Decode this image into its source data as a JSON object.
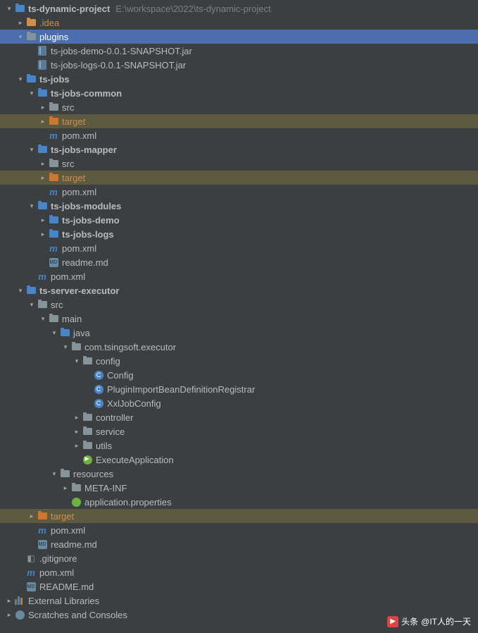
{
  "root": {
    "name": "ts-dynamic-project",
    "path": "E:\\workspace\\2022\\ts-dynamic-project"
  },
  "tree": [
    {
      "d": 0,
      "ar": "open",
      "ic": "folder-blue",
      "lbl": "ts-dynamic-project",
      "bold": true,
      "path": "E:\\workspace\\2022\\ts-dynamic-project"
    },
    {
      "d": 1,
      "ar": "closed",
      "ic": "folder-open",
      "lbl": ".idea",
      "orange": true
    },
    {
      "d": 1,
      "ar": "open",
      "ic": "folder-grey",
      "lbl": "plugins",
      "sel": true
    },
    {
      "d": 2,
      "ar": "none",
      "ic": "jar",
      "lbl": "ts-jobs-demo-0.0.1-SNAPSHOT.jar"
    },
    {
      "d": 2,
      "ar": "none",
      "ic": "jar",
      "lbl": "ts-jobs-logs-0.0.1-SNAPSHOT.jar"
    },
    {
      "d": 1,
      "ar": "open",
      "ic": "folder-blue",
      "lbl": "ts-jobs",
      "bold": true
    },
    {
      "d": 2,
      "ar": "open",
      "ic": "folder-blue",
      "lbl": "ts-jobs-common",
      "bold": true
    },
    {
      "d": 3,
      "ar": "closed",
      "ic": "folder-grey",
      "lbl": "src"
    },
    {
      "d": 3,
      "ar": "closed",
      "ic": "folder-orange",
      "lbl": "target",
      "orange": true,
      "hl": true
    },
    {
      "d": 3,
      "ar": "none",
      "ic": "maven",
      "lbl": "pom.xml"
    },
    {
      "d": 2,
      "ar": "open",
      "ic": "folder-blue",
      "lbl": "ts-jobs-mapper",
      "bold": true
    },
    {
      "d": 3,
      "ar": "closed",
      "ic": "folder-grey",
      "lbl": "src"
    },
    {
      "d": 3,
      "ar": "closed",
      "ic": "folder-orange",
      "lbl": "target",
      "orange": true,
      "hl": true
    },
    {
      "d": 3,
      "ar": "none",
      "ic": "maven",
      "lbl": "pom.xml"
    },
    {
      "d": 2,
      "ar": "open",
      "ic": "folder-blue",
      "lbl": "ts-jobs-modules",
      "bold": true
    },
    {
      "d": 3,
      "ar": "closed",
      "ic": "folder-blue",
      "lbl": "ts-jobs-demo",
      "bold": true
    },
    {
      "d": 3,
      "ar": "closed",
      "ic": "folder-blue",
      "lbl": "ts-jobs-logs",
      "bold": true
    },
    {
      "d": 3,
      "ar": "none",
      "ic": "maven",
      "lbl": "pom.xml"
    },
    {
      "d": 3,
      "ar": "none",
      "ic": "md",
      "lbl": "readme.md"
    },
    {
      "d": 2,
      "ar": "none",
      "ic": "maven",
      "lbl": "pom.xml"
    },
    {
      "d": 1,
      "ar": "open",
      "ic": "folder-blue",
      "lbl": "ts-server-executor",
      "bold": true
    },
    {
      "d": 2,
      "ar": "open",
      "ic": "folder-grey",
      "lbl": "src"
    },
    {
      "d": 3,
      "ar": "open",
      "ic": "folder-grey",
      "lbl": "main"
    },
    {
      "d": 4,
      "ar": "open",
      "ic": "folder-blue",
      "lbl": "java"
    },
    {
      "d": 5,
      "ar": "open",
      "ic": "folder-grey",
      "lbl": "com.tsingsoft.executor"
    },
    {
      "d": 6,
      "ar": "open",
      "ic": "folder-grey",
      "lbl": "config"
    },
    {
      "d": 7,
      "ar": "none",
      "ic": "class",
      "lbl": "Config"
    },
    {
      "d": 7,
      "ar": "none",
      "ic": "class",
      "lbl": "PluginImportBeanDefinitionRegistrar"
    },
    {
      "d": 7,
      "ar": "none",
      "ic": "class",
      "lbl": "XxlJobConfig"
    },
    {
      "d": 6,
      "ar": "closed",
      "ic": "folder-grey",
      "lbl": "controller"
    },
    {
      "d": 6,
      "ar": "closed",
      "ic": "folder-grey",
      "lbl": "service"
    },
    {
      "d": 6,
      "ar": "closed",
      "ic": "folder-grey",
      "lbl": "utils"
    },
    {
      "d": 6,
      "ar": "none",
      "ic": "boot",
      "lbl": "ExecuteApplication"
    },
    {
      "d": 4,
      "ar": "open",
      "ic": "folder-grey",
      "lbl": "resources"
    },
    {
      "d": 5,
      "ar": "closed",
      "ic": "folder-grey",
      "lbl": "META-INF"
    },
    {
      "d": 5,
      "ar": "none",
      "ic": "props",
      "lbl": "application.properties"
    },
    {
      "d": 2,
      "ar": "closed",
      "ic": "folder-orange",
      "lbl": "target",
      "orange": true,
      "hl": true
    },
    {
      "d": 2,
      "ar": "none",
      "ic": "maven",
      "lbl": "pom.xml"
    },
    {
      "d": 2,
      "ar": "none",
      "ic": "md",
      "lbl": "readme.md"
    },
    {
      "d": 1,
      "ar": "none",
      "ic": "git",
      "lbl": ".gitignore"
    },
    {
      "d": 1,
      "ar": "none",
      "ic": "maven",
      "lbl": "pom.xml"
    },
    {
      "d": 1,
      "ar": "none",
      "ic": "md",
      "lbl": "README.md"
    },
    {
      "d": 0,
      "ar": "closed",
      "ic": "lib",
      "lbl": "External Libraries"
    },
    {
      "d": 0,
      "ar": "closed",
      "ic": "scratch",
      "lbl": "Scratches and Consoles"
    }
  ],
  "watermark": {
    "prefix": "头条",
    "text": "@IT人的一天"
  }
}
